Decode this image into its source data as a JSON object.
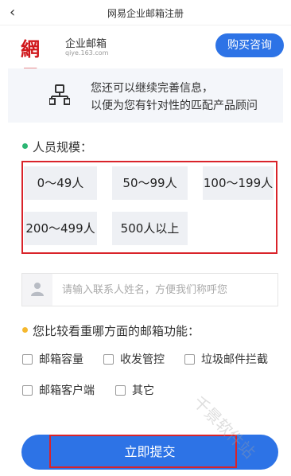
{
  "topbar": {
    "back_glyph": "‹",
    "title": "网易企业邮箱注册"
  },
  "brand": {
    "logo_text": "網易",
    "name": "企业邮箱",
    "domain": "qiye.163.com",
    "logo_color": "#d0171b"
  },
  "header": {
    "buy_button": "购买咨询"
  },
  "info": {
    "icon": "org-chart-icon",
    "line1": "您还可以继续完善信息，",
    "line2": "以便为您有针对性的匹配产品顾问"
  },
  "company_size": {
    "label": "人员规模：",
    "dot_color": "#2bb673",
    "options": [
      "0～49人",
      "50～99人",
      "100～199人",
      "200～499人",
      "500人以上"
    ]
  },
  "contact": {
    "icon": "person-icon",
    "placeholder": "请输入联系人姓名，方便我们称呼您"
  },
  "features": {
    "label": "您比较看重哪方面的邮箱功能：",
    "dot_color": "#f5b82e",
    "options": [
      "邮箱容量",
      "收发管控",
      "垃圾邮件拦截",
      "邮箱客户端",
      "其它"
    ]
  },
  "submit": {
    "label": "立即提交"
  },
  "watermark": "千景软件站",
  "colors": {
    "accent": "#2d73e6",
    "highlight": "#d9232a"
  }
}
